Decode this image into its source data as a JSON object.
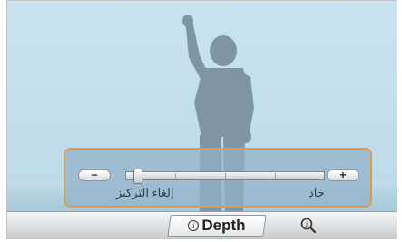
{
  "depth_control": {
    "minus_label": "−",
    "plus_label": "+",
    "left_caption": "إلغاء التركيز",
    "right_caption": "حاد",
    "level": 0.04
  },
  "toolbar": {
    "depth_tab_label": "Depth",
    "depth_tab_icon": "info-icon",
    "zoom_icon": "magnifier-icon"
  },
  "colors": {
    "accent_border": "#e39a3c",
    "sky": "#c5e0ef",
    "silhouette": "#7f95a6"
  }
}
